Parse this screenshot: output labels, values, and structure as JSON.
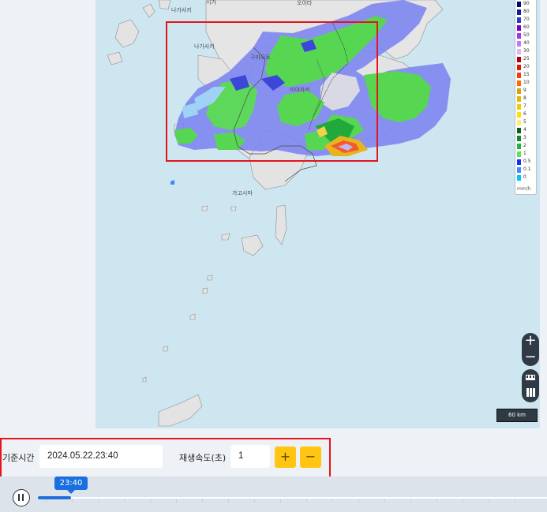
{
  "map": {
    "labels": {
      "top1": "시가",
      "top2": "오이타",
      "nagasaki_top": "나가사키",
      "nagasaki": "나가사키",
      "kumamoto": "구마모토",
      "miyazaki": "미야자키",
      "kagoshima": "가고시마"
    },
    "scale_label": "60 km"
  },
  "legend": {
    "unit": "mm/h",
    "items": [
      {
        "label": "90",
        "color": "#000a6b"
      },
      {
        "label": "80",
        "color": "#0f1f94"
      },
      {
        "label": "70",
        "color": "#2b39c6"
      },
      {
        "label": "60",
        "color": "#7a00c9"
      },
      {
        "label": "50",
        "color": "#a236e8"
      },
      {
        "label": "40",
        "color": "#c37aef"
      },
      {
        "label": "30",
        "color": "#dcb5f3"
      },
      {
        "label": "25",
        "color": "#b40000"
      },
      {
        "label": "20",
        "color": "#d71a0f"
      },
      {
        "label": "15",
        "color": "#f23b0d"
      },
      {
        "label": "10",
        "color": "#ff6a00"
      },
      {
        "label": "9",
        "color": "#d6a400"
      },
      {
        "label": "8",
        "color": "#e4b600"
      },
      {
        "label": "7",
        "color": "#f2cc00"
      },
      {
        "label": "6",
        "color": "#ffe000"
      },
      {
        "label": "5",
        "color": "#fff06a"
      },
      {
        "label": "4",
        "color": "#0a5e1f"
      },
      {
        "label": "3",
        "color": "#0e8a2c"
      },
      {
        "label": "2",
        "color": "#22b53b"
      },
      {
        "label": "1",
        "color": "#5fe04e"
      },
      {
        "label": "0.5",
        "color": "#1a2bff"
      },
      {
        "label": "0.1",
        "color": "#3b8cff"
      },
      {
        "label": "0",
        "color": "#00c4ff"
      }
    ]
  },
  "controls": {
    "base_time_label": "기준시간",
    "base_time_value": "2024.05.22.23:40",
    "speed_label": "재생속도(초)",
    "speed_value": "1",
    "plus_label": "+",
    "minus_label": "−",
    "zoom_in": "+",
    "zoom_out": "−"
  },
  "timeline": {
    "current_time": "23:40",
    "progress_fraction": 0.065,
    "play_state_icon": "pause-icon"
  },
  "colors": {
    "highlight": "#e3141b",
    "accent_yellow": "#ffc510",
    "timeline_blue": "#1a6fe0"
  }
}
